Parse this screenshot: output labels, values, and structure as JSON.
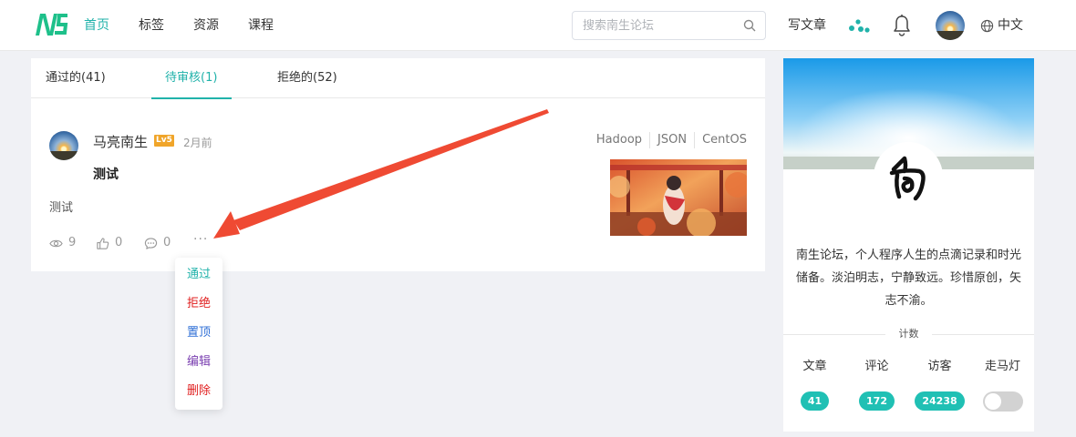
{
  "header": {
    "logo_text": "NS",
    "nav": [
      {
        "label": "首页",
        "active": true
      },
      {
        "label": "标签",
        "active": false
      },
      {
        "label": "资源",
        "active": false
      },
      {
        "label": "课程",
        "active": false
      }
    ],
    "search_placeholder": "搜索南生论坛",
    "write_label": "写文章",
    "language": "中文",
    "accent_color": "#20b2aa"
  },
  "tabs": [
    {
      "label": "通过的(41)",
      "active": false
    },
    {
      "label": "待审核(1)",
      "active": true
    },
    {
      "label": "拒绝的(52)",
      "active": false
    }
  ],
  "post": {
    "author": "马亮南生",
    "level_badge": "Lv5",
    "time": "2月前",
    "title": "测试",
    "body": "测试",
    "tags": [
      "Hadoop",
      "JSON",
      "CentOS"
    ],
    "views": "9",
    "likes": "0",
    "comments": "0",
    "more": "···"
  },
  "menu": [
    {
      "label": "通过",
      "color": "#20b2aa"
    },
    {
      "label": "拒绝",
      "color": "#e02020"
    },
    {
      "label": "置顶",
      "color": "#2f6fd6"
    },
    {
      "label": "编辑",
      "color": "#7a3fb0"
    },
    {
      "label": "删除",
      "color": "#e02020"
    }
  ],
  "sidebar": {
    "description": "南生论坛，个人程序人生的点滴记录和时光储备。淡泊明志，宁静致远。珍惜原创，矢志不渝。",
    "count_label": "计数",
    "stats": [
      {
        "label": "文章",
        "value": "41"
      },
      {
        "label": "评论",
        "value": "172"
      },
      {
        "label": "访客",
        "value": "24238"
      }
    ],
    "marquee_label": "走马灯",
    "marquee_on": false
  }
}
